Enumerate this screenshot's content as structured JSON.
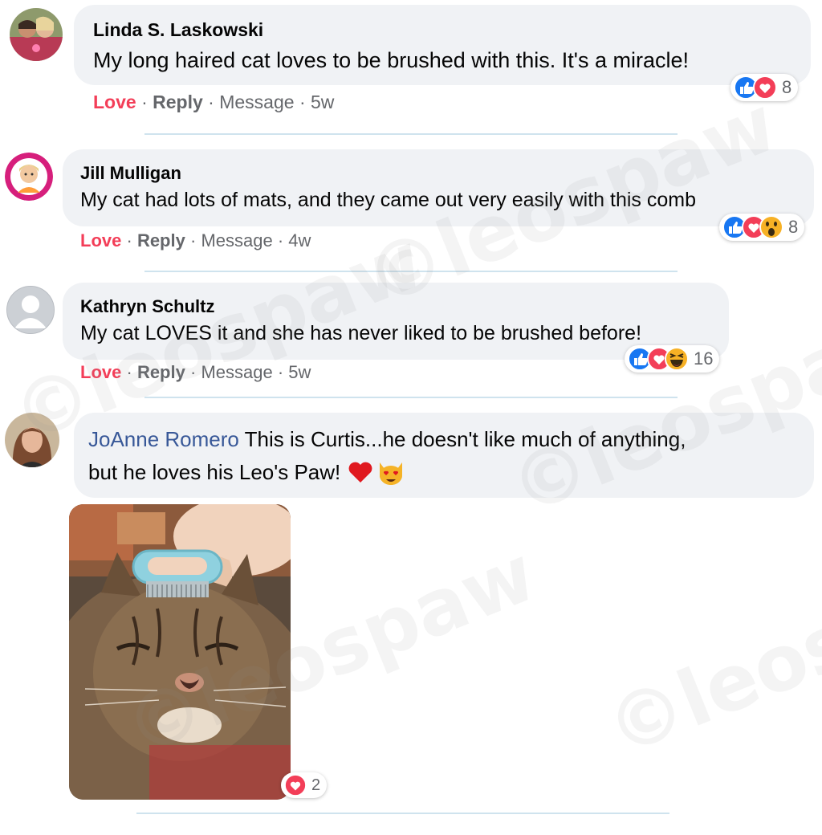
{
  "comments": [
    {
      "author": "Linda S. Laskowski",
      "text": "My long haired cat loves to be brushed with this. It's a miracle!",
      "actions": {
        "love": "Love",
        "reply": "Reply",
        "message": "Message",
        "age": "5w"
      },
      "reactions": {
        "icons": [
          "like",
          "love"
        ],
        "count": "8"
      }
    },
    {
      "author": "Jill Mulligan",
      "text": "My cat had lots of mats, and they came out very easily with this comb",
      "actions": {
        "love": "Love",
        "reply": "Reply",
        "message": "Message",
        "age": "4w"
      },
      "reactions": {
        "icons": [
          "like",
          "love",
          "wow"
        ],
        "count": "8"
      }
    },
    {
      "author": "Kathryn Schultz",
      "text": "My cat LOVES it and she has never liked to be brushed before!",
      "actions": {
        "love": "Love",
        "reply": "Reply",
        "message": "Message",
        "age": "5w"
      },
      "reactions": {
        "icons": [
          "like",
          "love",
          "haha"
        ],
        "count": "16"
      }
    },
    {
      "author": "JoAnne Romero",
      "text_line1": "This is Curtis...he doesn't like much of anything,",
      "text_line2": "but he loves his Leo's Paw!",
      "emoji": [
        "red-heart",
        "heart-eyes-cat"
      ],
      "photo": {
        "subject": "tabby cat being brushed with blue pet comb",
        "reactions": {
          "icons": [
            "love"
          ],
          "count": "2"
        }
      }
    }
  ],
  "watermark": "©leospaw",
  "colors": {
    "bubble": "#f0f2f5",
    "love": "#f33e58",
    "meta": "#65676b",
    "link_name": "#385898",
    "divider": "#cfe3ee",
    "like_blue": "#1877f2"
  }
}
